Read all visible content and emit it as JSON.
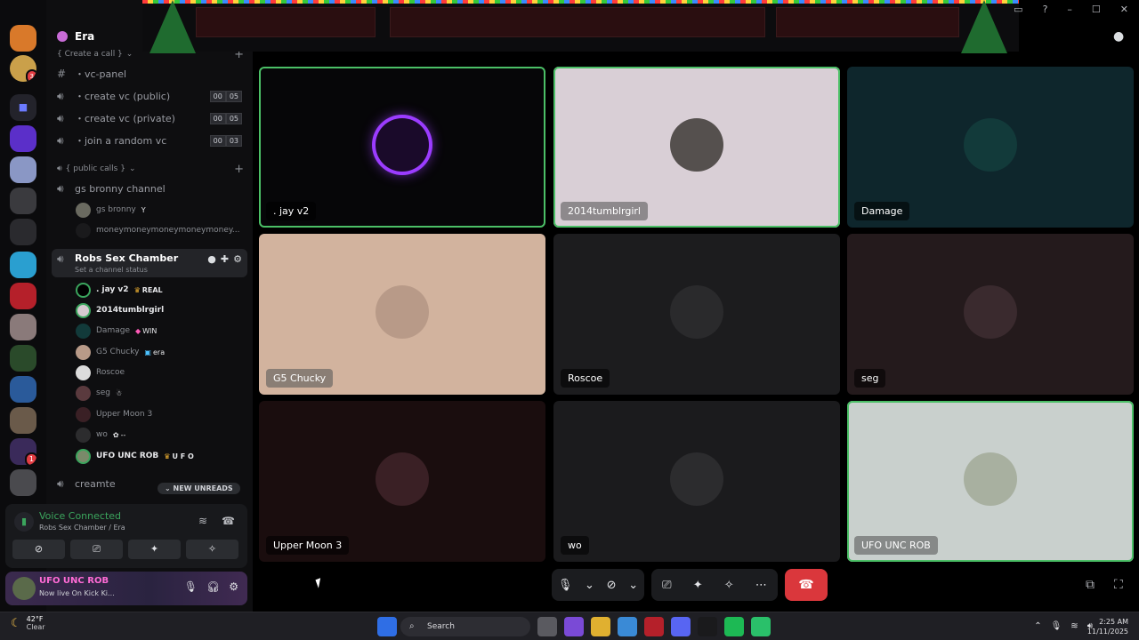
{
  "server": {
    "name": "Era"
  },
  "categories": [
    {
      "label": "{ Create a call }"
    },
    {
      "label": "{ public calls }"
    }
  ],
  "channels_top": [
    {
      "name": "・vc-panel",
      "icon": "hashtag-icon"
    },
    {
      "name": "・create vc (public)",
      "icon": "speaker-icon",
      "count_a": "00",
      "count_b": "05"
    },
    {
      "name": "・create vc (private)",
      "icon": "speaker-icon",
      "count_a": "00",
      "count_b": "05"
    },
    {
      "name": "・join a random vc",
      "icon": "speaker-icon",
      "count_a": "00",
      "count_b": "03"
    }
  ],
  "public_channel": {
    "name": "gs bronny channel",
    "members": [
      "gs bronny",
      "moneymoneymoneymoneymoney..."
    ]
  },
  "active_channel": {
    "name": "Robs Sex Chamber",
    "status": "Set a channel status"
  },
  "members": [
    {
      "name": ". jay v2",
      "tag": "REAL",
      "bright": true
    },
    {
      "name": "2014tumblrgirl",
      "tag": "",
      "bright": true
    },
    {
      "name": "Damage",
      "tag": "WIN",
      "bright": false
    },
    {
      "name": "G5 Chucky",
      "tag": "era",
      "bright": false
    },
    {
      "name": "Roscoe",
      "tag": "",
      "bright": false
    },
    {
      "name": "seg",
      "tag": "",
      "bright": false
    },
    {
      "name": "Upper Moon 3",
      "tag": "",
      "bright": false
    },
    {
      "name": "wo",
      "tag": "--",
      "bright": false
    },
    {
      "name": "UFO UNC ROB",
      "tag": "U F O",
      "bright": true
    }
  ],
  "next_channel": {
    "name": "creamte"
  },
  "new_unreads": "NEW UNREADS",
  "voice": {
    "status": "Voice Connected",
    "location": "Robs Sex Chamber / Era"
  },
  "user": {
    "name": "UFO UNC ROB",
    "status": "Now live On Kick Ki..."
  },
  "tiles": [
    {
      "label": ". jay v2",
      "speaking": true,
      "bg": "#060608",
      "circle": "#1a0a2a",
      "ring": true
    },
    {
      "label": "2014tumblrgirl",
      "speaking": true,
      "bg": "#d9cfd6",
      "circle": "#55504e",
      "ring": false
    },
    {
      "label": "Damage",
      "speaking": false,
      "bg": "#0e262c",
      "circle": "#123a3a",
      "ring": false
    },
    {
      "label": "G5 Chucky",
      "speaking": false,
      "bg": "#d2b39e",
      "circle": "#b89a88",
      "ring": false
    },
    {
      "label": "Roscoe",
      "speaking": false,
      "bg": "#1c1c1e",
      "circle": "#2a2a2c",
      "ring": false
    },
    {
      "label": "seg",
      "speaking": false,
      "bg": "#241a1c",
      "circle": "#3a2a2e",
      "ring": false
    },
    {
      "label": "Upper Moon 3",
      "speaking": false,
      "bg": "#1a0d0e",
      "circle": "#3a2025",
      "ring": false
    },
    {
      "label": "wo",
      "speaking": false,
      "bg": "#1b1b1d",
      "circle": "#2c2c2e",
      "ring": false
    },
    {
      "label": "UFO UNC ROB",
      "speaking": true,
      "bg": "#c9d0cd",
      "circle": "#a8b0a0",
      "ring": false
    }
  ],
  "taskbar": {
    "weather_temp": "42°F",
    "weather_desc": "Clear",
    "search_placeholder": "Search",
    "time": "2:25 AM",
    "date": "11/11/2025"
  },
  "colors": {
    "accent_green": "#3ba55d",
    "hangup_red": "#da373c",
    "speaking_outline": "#4bbf66"
  }
}
